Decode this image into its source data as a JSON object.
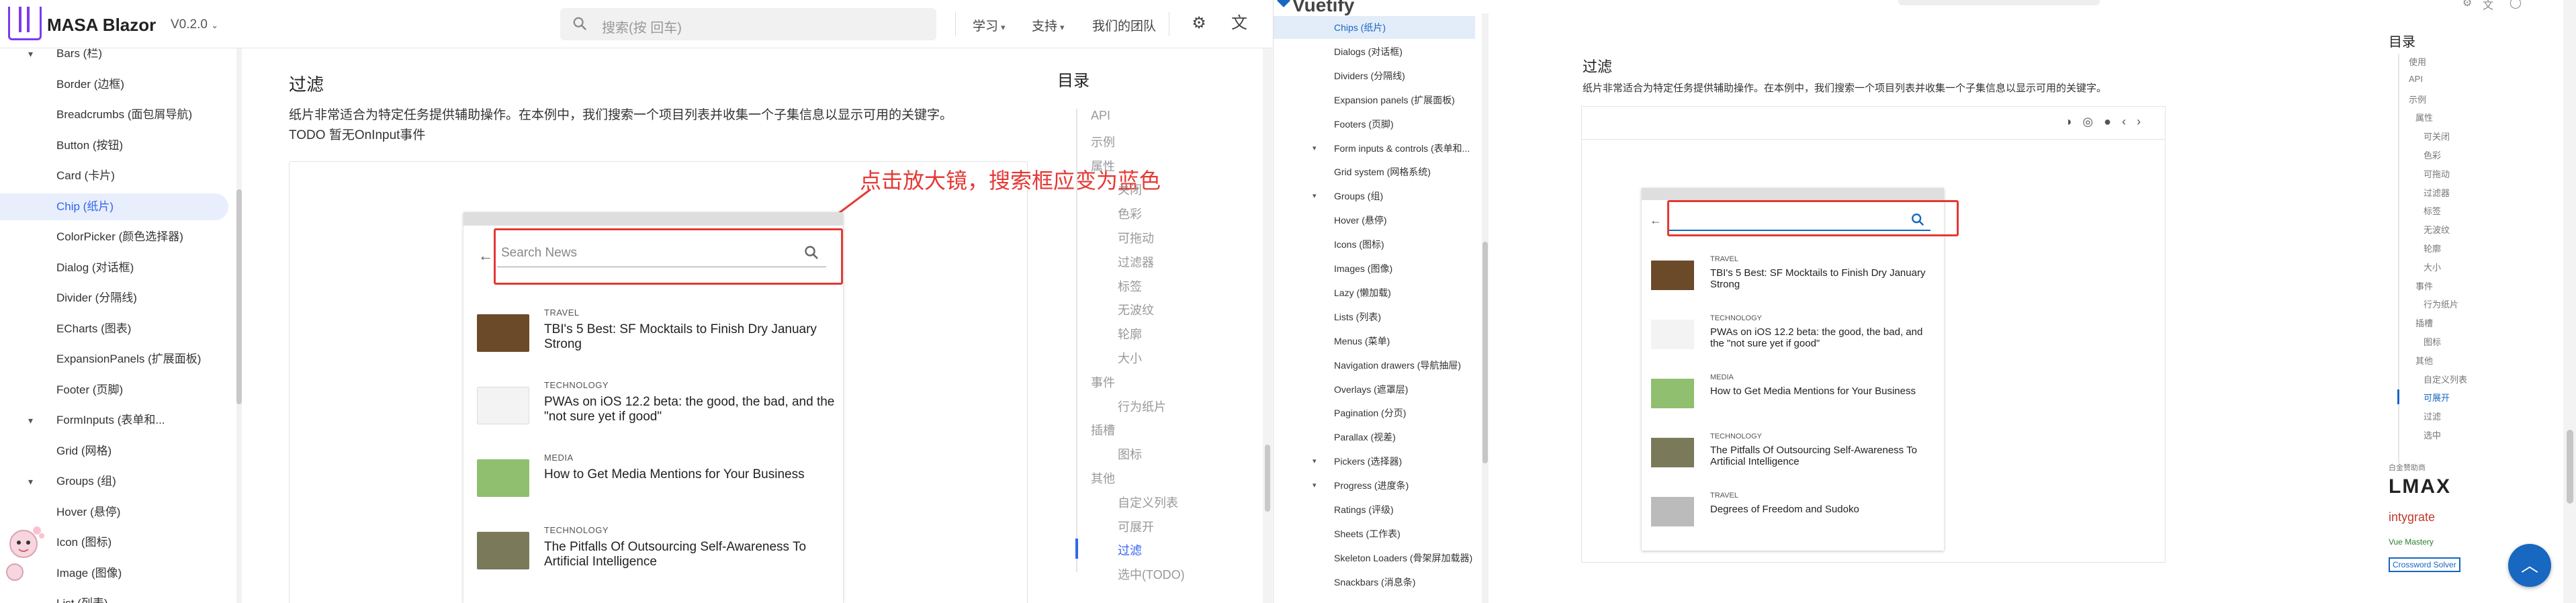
{
  "left": {
    "brand": "MASA Blazor",
    "version": "V0.2.0",
    "search_placeholder": "搜索(按 回车)",
    "nav": [
      "学习",
      "支持",
      "我们的团队"
    ],
    "sidebar": {
      "items": [
        {
          "label": "Bars (栏)",
          "type": "group"
        },
        {
          "label": "Border (边框)"
        },
        {
          "label": "Breadcrumbs (面包屑导航)"
        },
        {
          "label": "Button (按钮)"
        },
        {
          "label": "Card (卡片)"
        },
        {
          "label": "Chip (纸片)",
          "active": true
        },
        {
          "label": "ColorPicker (颜色选择器)"
        },
        {
          "label": "Dialog (对话框)"
        },
        {
          "label": "Divider (分隔线)"
        },
        {
          "label": "ECharts (图表)"
        },
        {
          "label": "ExpansionPanels (扩展面板)"
        },
        {
          "label": "Footer (页脚)"
        },
        {
          "label": "FormInputs (表单和...",
          "type": "group"
        },
        {
          "label": "Grid (网格)"
        },
        {
          "label": "Groups (组)",
          "type": "group"
        },
        {
          "label": "Hover (悬停)"
        },
        {
          "label": "Icon (图标)"
        },
        {
          "label": "Image (图像)"
        },
        {
          "label": "List (列表)"
        }
      ]
    },
    "main": {
      "heading": "过滤",
      "description": "纸片非常适合为特定任务提供辅助操作。在本例中，我们搜索一个项目列表并收集一个子集信息以显示可用的关键字。",
      "todo": "TODO 暂无OnInput事件",
      "annotation": "点击放大镜，搜索框应变为蓝色",
      "demo": {
        "search_placeholder": "Search News",
        "news": [
          {
            "category": "TRAVEL",
            "title": "TBI's 5 Best: SF Mocktails to Finish Dry January Strong"
          },
          {
            "category": "TECHNOLOGY",
            "title": "PWAs on iOS 12.2 beta: the good, the bad, and the \"not sure yet if good\""
          },
          {
            "category": "MEDIA",
            "title": "How to Get Media Mentions for Your Business"
          },
          {
            "category": "TECHNOLOGY",
            "title": "The Pitfalls Of Outsourcing Self-Awareness To Artificial Intelligence"
          }
        ]
      }
    },
    "toc": {
      "title": "目录",
      "items": [
        {
          "label": "API",
          "level": 0
        },
        {
          "label": "示例",
          "level": 0
        },
        {
          "label": "属性",
          "level": 1
        },
        {
          "label": "关闭",
          "level": 2
        },
        {
          "label": "色彩",
          "level": 2
        },
        {
          "label": "可拖动",
          "level": 2
        },
        {
          "label": "过滤器",
          "level": 2
        },
        {
          "label": "标签",
          "level": 2
        },
        {
          "label": "无波纹",
          "level": 2
        },
        {
          "label": "轮廓",
          "level": 2
        },
        {
          "label": "大小",
          "level": 2
        },
        {
          "label": "事件",
          "level": 1
        },
        {
          "label": "行为纸片",
          "level": 2
        },
        {
          "label": "插槽",
          "level": 1
        },
        {
          "label": "图标",
          "level": 2
        },
        {
          "label": "其他",
          "level": 1
        },
        {
          "label": "自定义列表",
          "level": 2
        },
        {
          "label": "可展开",
          "level": 2
        },
        {
          "label": "过滤",
          "level": 2,
          "active": true
        },
        {
          "label": "选中(TODO)",
          "level": 2
        }
      ]
    }
  },
  "right": {
    "brand": "Vuetify",
    "sidebar": {
      "items": [
        {
          "label": "Chips (纸片)",
          "active": true
        },
        {
          "label": "Dialogs (对话框)"
        },
        {
          "label": "Dividers (分隔线)"
        },
        {
          "label": "Expansion panels (扩展面板)"
        },
        {
          "label": "Footers (页脚)"
        },
        {
          "label": "Form inputs & controls (表单和...",
          "type": "group"
        },
        {
          "label": "Grid system (网格系统)"
        },
        {
          "label": "Groups (组)",
          "type": "group"
        },
        {
          "label": "Hover (悬停)"
        },
        {
          "label": "Icons (图标)"
        },
        {
          "label": "Images (图像)"
        },
        {
          "label": "Lazy (懒加载)"
        },
        {
          "label": "Lists (列表)"
        },
        {
          "label": "Menus (菜单)"
        },
        {
          "label": "Navigation drawers (导航抽屉)"
        },
        {
          "label": "Overlays (遮罩层)"
        },
        {
          "label": "Pagination (分页)"
        },
        {
          "label": "Parallax (视差)"
        },
        {
          "label": "Pickers (选择器)",
          "type": "group"
        },
        {
          "label": "Progress (进度条)",
          "type": "group"
        },
        {
          "label": "Ratings (评级)"
        },
        {
          "label": "Sheets (工作表)"
        },
        {
          "label": "Skeleton Loaders (骨架屏加载器)"
        },
        {
          "label": "Snackbars (消息条)"
        }
      ]
    },
    "main": {
      "heading": "过滤",
      "description": "纸片非常适合为特定任务提供辅助操作。在本例中，我们搜索一个项目列表并收集一个子集信息以显示可用的关键字。",
      "news": [
        {
          "category": "TRAVEL",
          "title": "TBI's 5 Best: SF Mocktails to Finish Dry January Strong"
        },
        {
          "category": "TECHNOLOGY",
          "title": "PWAs on iOS 12.2 beta: the good, the bad, and the \"not sure yet if good\""
        },
        {
          "category": "MEDIA",
          "title": "How to Get Media Mentions for Your Business"
        },
        {
          "category": "TECHNOLOGY",
          "title": "The Pitfalls Of Outsourcing Self-Awareness To Artificial Intelligence"
        },
        {
          "category": "TRAVEL",
          "title": "Degrees of Freedom and Sudoko"
        }
      ]
    },
    "toc": {
      "title": "目录",
      "items": [
        {
          "label": "使用",
          "level": 0
        },
        {
          "label": "API",
          "level": 0
        },
        {
          "label": "示例",
          "level": 0
        },
        {
          "label": "属性",
          "level": 1
        },
        {
          "label": "可关闭",
          "level": 2
        },
        {
          "label": "色彩",
          "level": 2
        },
        {
          "label": "可拖动",
          "level": 2
        },
        {
          "label": "过滤器",
          "level": 2
        },
        {
          "label": "标签",
          "level": 2
        },
        {
          "label": "无波纹",
          "level": 2
        },
        {
          "label": "轮廓",
          "level": 2
        },
        {
          "label": "大小",
          "level": 2
        },
        {
          "label": "事件",
          "level": 1
        },
        {
          "label": "行为纸片",
          "level": 2
        },
        {
          "label": "插槽",
          "level": 1
        },
        {
          "label": "图标",
          "level": 2
        },
        {
          "label": "其他",
          "level": 1
        },
        {
          "label": "自定义列表",
          "level": 2
        },
        {
          "label": "可展开",
          "level": 2,
          "active": true
        },
        {
          "label": "过滤",
          "level": 2
        },
        {
          "label": "选中",
          "level": 2
        }
      ],
      "sponsor_label": "白金赞助商",
      "sponsors": [
        "LMAX",
        "intygrate",
        "Vue Mastery",
        "Crossword Solver"
      ]
    }
  },
  "colors": {
    "masa_accent": "#7c3aed",
    "masa_link": "#3366ee",
    "annotation_red": "#e53935",
    "vuetify_primary": "#1867c0"
  }
}
